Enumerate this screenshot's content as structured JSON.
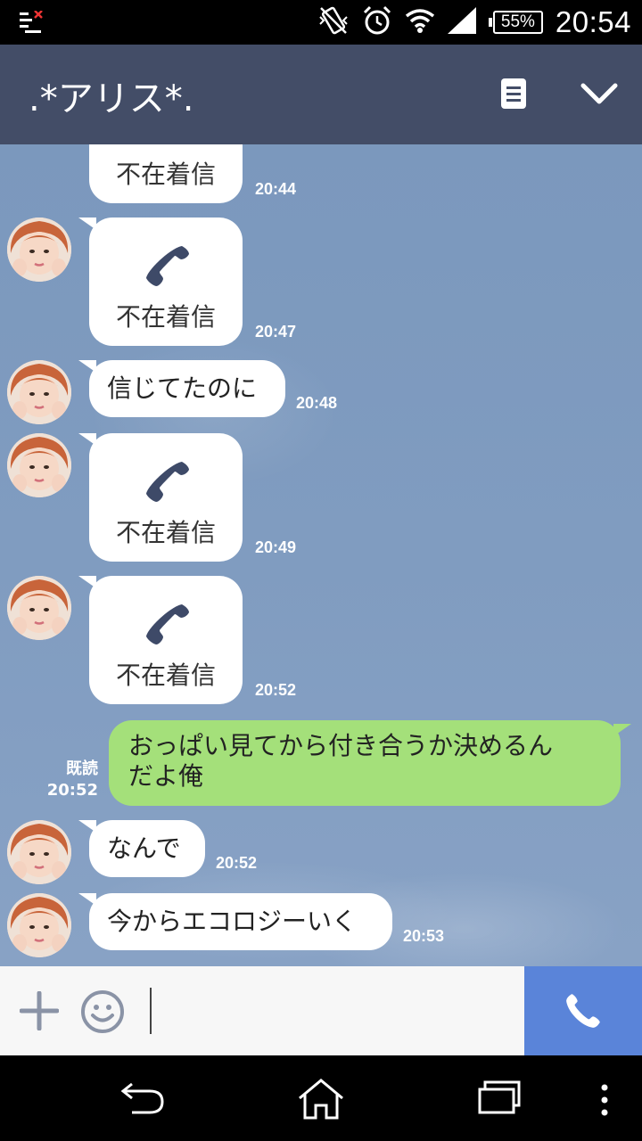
{
  "status_bar": {
    "battery": "55%",
    "clock": "20:54"
  },
  "header": {
    "title": ".*アリス*."
  },
  "messages": [
    {
      "type": "call",
      "label": "不在着信",
      "time": "20:44"
    },
    {
      "type": "call",
      "label": "不在着信",
      "time": "20:47"
    },
    {
      "type": "text",
      "text": "信じてたのに",
      "time": "20:48"
    },
    {
      "type": "call",
      "label": "不在着信",
      "time": "20:49"
    },
    {
      "type": "call",
      "label": "不在着信",
      "time": "20:52"
    },
    {
      "type": "sent",
      "line1": "おっぱい見てから付き合うか決めるん",
      "line2": "だよ俺",
      "read": "既読",
      "time": "20:52"
    },
    {
      "type": "text",
      "text": "なんで",
      "time": "20:52"
    },
    {
      "type": "text",
      "text": "今からエコロジーいく",
      "time": "20:53"
    }
  ],
  "input": {
    "value": ""
  },
  "icons": {
    "status_left": "notification-icon",
    "vibrate": "vibrate-icon",
    "alarm": "alarm-icon",
    "wifi": "wifi-icon",
    "signal": "signal-icon",
    "notes": "notes-icon",
    "collapse": "chevron-down-icon",
    "missed_call": "phone-icon",
    "add": "plus-icon",
    "emoji": "smiley-icon",
    "voice_call": "phone-icon",
    "back": "back-icon",
    "home": "home-icon",
    "recent": "recent-apps-icon",
    "menu": "more-vert-icon"
  },
  "colors": {
    "header_bg": "#434d67",
    "chat_bg": "#809cc0",
    "sent_bubble": "#a4e07a",
    "received_bubble": "#ffffff",
    "call_button": "#5a84d9",
    "phone_icon": "#3e4a68"
  }
}
